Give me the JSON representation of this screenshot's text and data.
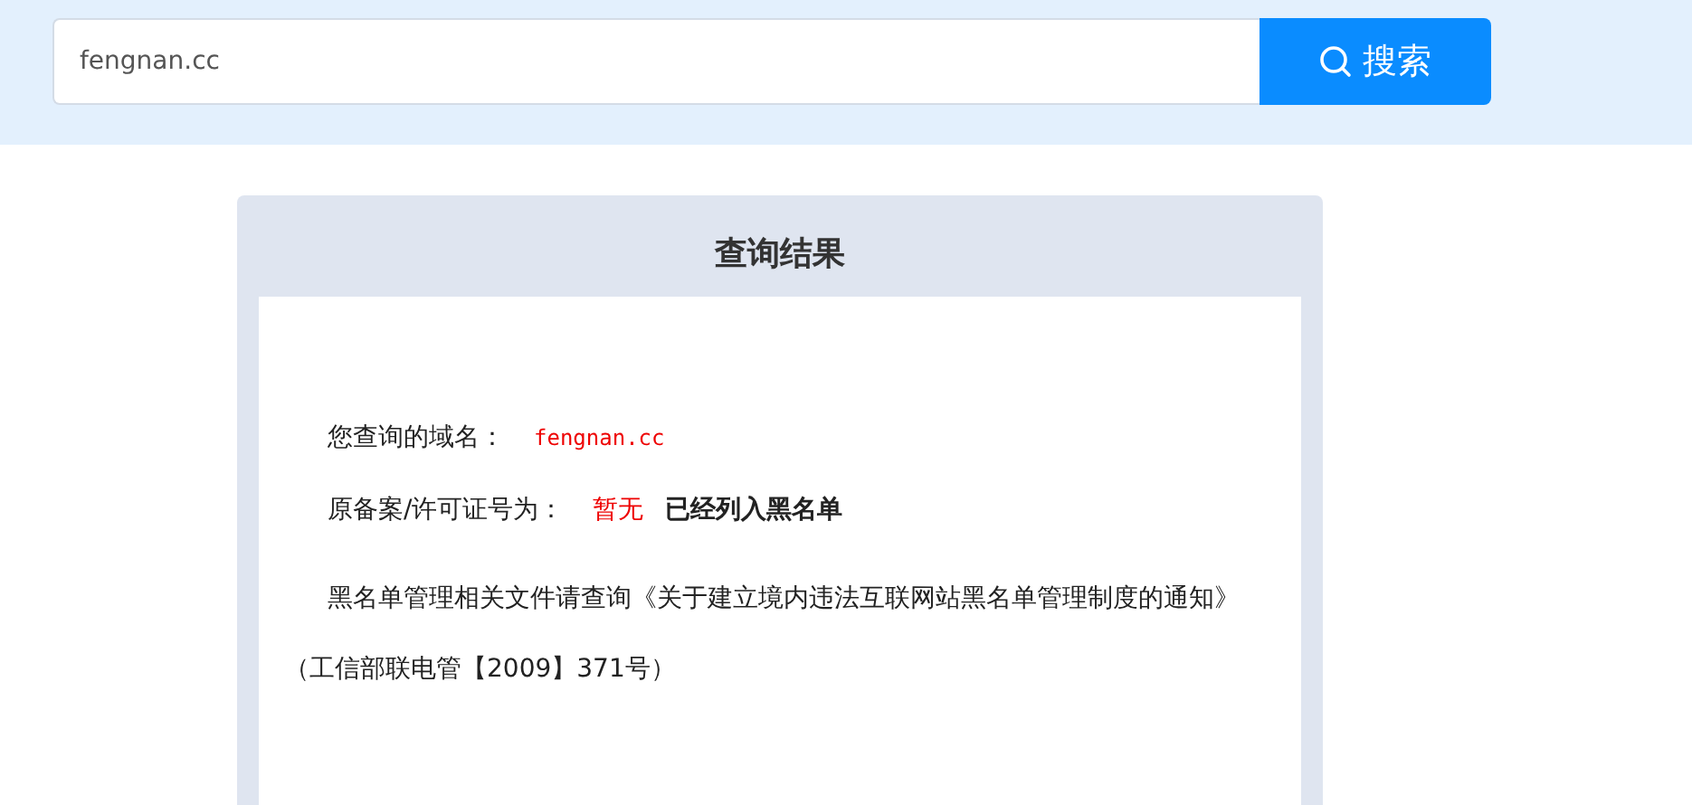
{
  "search": {
    "value": "fengnan.cc",
    "button": "搜索"
  },
  "result": {
    "title": "查询结果",
    "domain_label": "您查询的域名：",
    "domain": "fengnan.cc",
    "license_label": "原备案/许可证号为：",
    "license": "暂无",
    "status": "已经列入黑名单",
    "notice": "黑名单管理相关文件请查询《关于建立境内违法互联网站黑名单管理制度的通知》",
    "notice_ref": "（工信部联电管【2009】371号）"
  }
}
